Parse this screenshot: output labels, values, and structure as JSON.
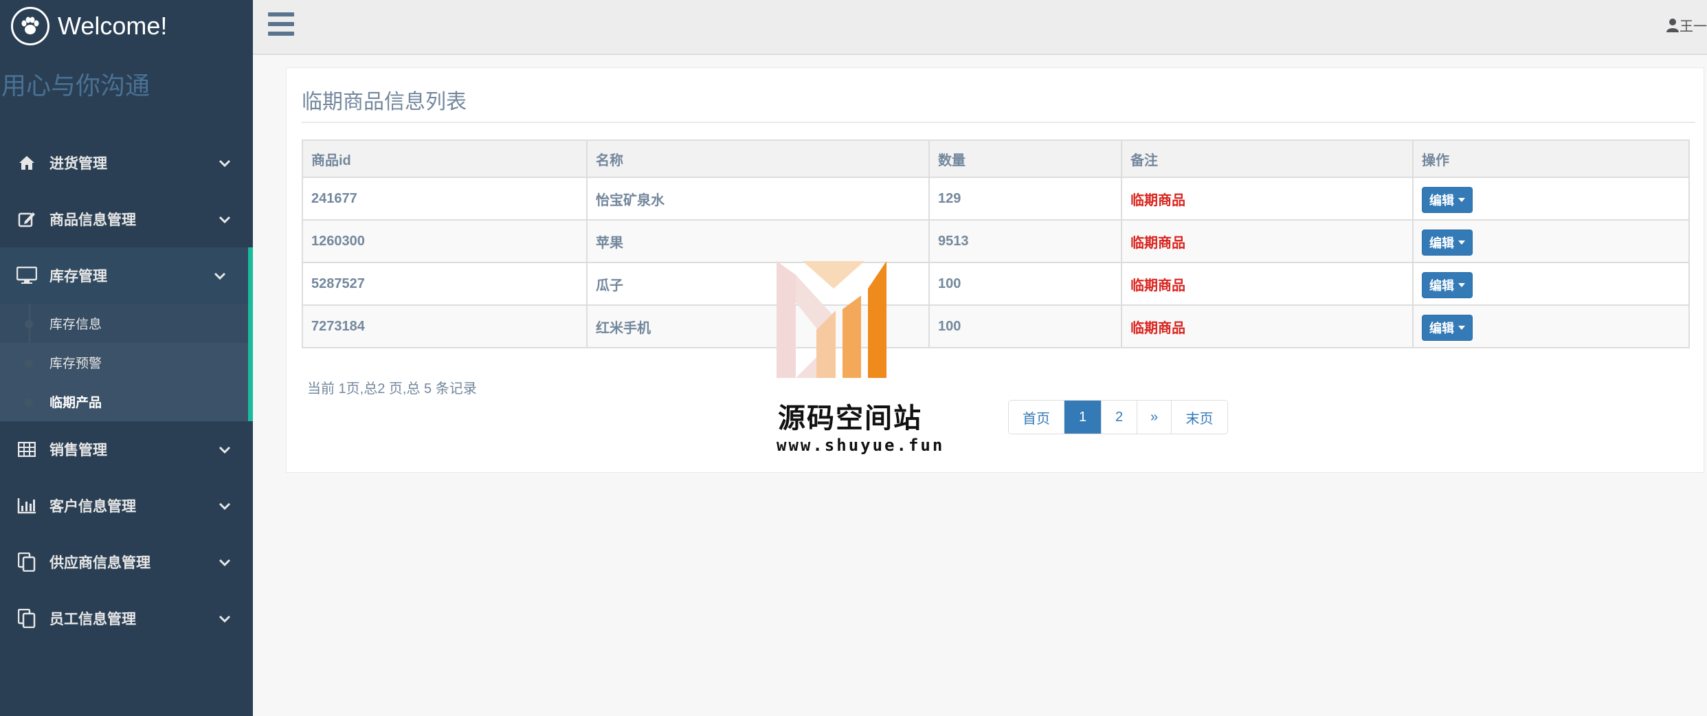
{
  "sidebar": {
    "welcome": "Welcome!",
    "slogan": "用心与你沟通",
    "items": [
      {
        "label": "进货管理",
        "icon": "home-icon"
      },
      {
        "label": "商品信息管理",
        "icon": "edit-icon"
      },
      {
        "label": "库存管理",
        "icon": "desktop-icon"
      },
      {
        "label": "销售管理",
        "icon": "table-icon"
      },
      {
        "label": "客户信息管理",
        "icon": "bar-chart-icon"
      },
      {
        "label": "供应商信息管理",
        "icon": "copy-icon"
      },
      {
        "label": "员工信息管理",
        "icon": "copy-icon"
      }
    ],
    "submenu": [
      {
        "label": "库存信息"
      },
      {
        "label": "库存预警"
      },
      {
        "label": "临期产品"
      }
    ]
  },
  "topnav": {
    "user": "王一"
  },
  "panel": {
    "title": "临期商品信息列表",
    "columns": [
      "商品id",
      "名称",
      "数量",
      "备注",
      "操作"
    ],
    "rows": [
      {
        "id": "241677",
        "name": "怡宝矿泉水",
        "qty": "129",
        "note": "临期商品",
        "action": "编辑"
      },
      {
        "id": "1260300",
        "name": "苹果",
        "qty": "9513",
        "note": "临期商品",
        "action": "编辑"
      },
      {
        "id": "5287527",
        "name": "瓜子",
        "qty": "100",
        "note": "临期商品",
        "action": "编辑"
      },
      {
        "id": "7273184",
        "name": "红米手机",
        "qty": "100",
        "note": "临期商品",
        "action": "编辑"
      }
    ],
    "summary": "当前 1页,总2 页,总 5 条记录"
  },
  "pager": {
    "first": "首页",
    "page1": "1",
    "page2": "2",
    "next": "»",
    "last": "末页"
  },
  "watermark": {
    "title": "源码空间站",
    "url": "www.shuyue.fun"
  },
  "colors": {
    "sidebar": "#2a3f54",
    "accent": "#1abb9c",
    "primary": "#337ab7",
    "note": "#d9231d"
  }
}
